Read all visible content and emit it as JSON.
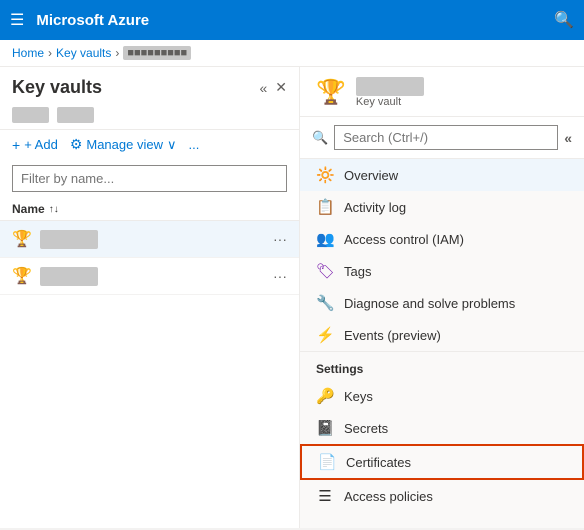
{
  "topbar": {
    "title": "Microsoft Azure",
    "hamburger_icon": "☰",
    "search_icon": "🔍"
  },
  "breadcrumb": {
    "home": "Home",
    "keyvaults": "Key vaults",
    "current_blurred": "■■■■■■■■■■"
  },
  "left_panel": {
    "title": "Key vaults",
    "subtitle_blurred1": "■■■■■■■■■",
    "subtitle_blurred2": "■■■■■■■■■■■■■",
    "toolbar": {
      "add_label": "+ Add",
      "manage_view_label": "Manage view",
      "more_label": "..."
    },
    "filter_placeholder": "Filter by name...",
    "column_name": "Name",
    "sort_icon": "↑↓",
    "items": [
      {
        "icon": "🔑",
        "name_blurred": "■■■■■■■■■■■■■■",
        "more": "..."
      },
      {
        "icon": "🔑",
        "name_blurred": "■■■■■■■■■■■■■",
        "more": "..."
      }
    ]
  },
  "right_panel": {
    "header": {
      "icon": "🏆",
      "title_blurred": "■■■■■■■■■■■■■■■■",
      "subtitle": "Key vault"
    },
    "search_placeholder": "Search (Ctrl+/)",
    "collapse_label": "«",
    "nav_items": [
      {
        "id": "overview",
        "icon": "🔆",
        "label": "Overview",
        "active": true
      },
      {
        "id": "activity-log",
        "icon": "📋",
        "label": "Activity log",
        "active": false
      },
      {
        "id": "access-control",
        "icon": "👥",
        "label": "Access control (IAM)",
        "active": false
      },
      {
        "id": "tags",
        "icon": "🏷",
        "label": "Tags",
        "active": false
      },
      {
        "id": "diagnose",
        "icon": "🔧",
        "label": "Diagnose and solve problems",
        "active": false
      },
      {
        "id": "events",
        "icon": "⚡",
        "label": "Events (preview)",
        "active": false
      }
    ],
    "settings_section": {
      "title": "Settings",
      "items": [
        {
          "id": "keys",
          "icon": "🔑",
          "label": "Keys",
          "active": false
        },
        {
          "id": "secrets",
          "icon": "📓",
          "label": "Secrets",
          "active": false
        },
        {
          "id": "certificates",
          "icon": "📄",
          "label": "Certificates",
          "active": false,
          "highlighted": true
        },
        {
          "id": "access-policies",
          "icon": "☰",
          "label": "Access policies",
          "active": false
        }
      ]
    }
  }
}
